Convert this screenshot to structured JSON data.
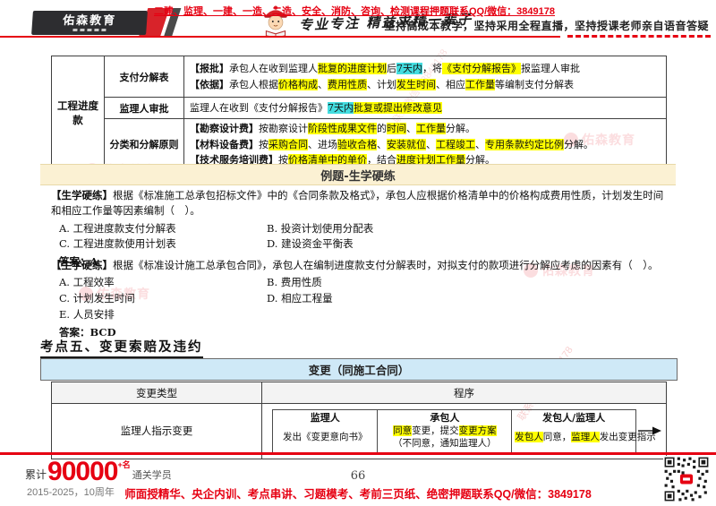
{
  "header": {
    "logo_text": "佑森教育",
    "slogan": "专业专注 精益求精一辈子",
    "courses_line": "二建、监理、一建、一造、二造、安全、消防、咨询、检测课程押题联系QQ/微信：3849178",
    "promise_line": "坚持高成本教学，坚持采用全程直播，坚持授课老师亲自语音答疑"
  },
  "table1": {
    "group_label": "工程进度款",
    "rows": [
      {
        "label": "支付分解表",
        "lines": [
          [
            {
              "t": "【报批】",
              "b": true
            },
            {
              "t": "承包人在收到监理人"
            },
            {
              "t": "批复的进度计划",
              "h": "y"
            },
            {
              "t": "后"
            },
            {
              "t": "7天内",
              "h": "c"
            },
            {
              "t": "，将"
            },
            {
              "t": "《支付分解报告》",
              "h": "y"
            },
            {
              "t": "报监理人审批"
            }
          ],
          [
            {
              "t": "【依据】",
              "b": true
            },
            {
              "t": "承包人根据"
            },
            {
              "t": "价格构成",
              "h": "y"
            },
            {
              "t": "、"
            },
            {
              "t": "费用性质",
              "h": "y"
            },
            {
              "t": "、计划"
            },
            {
              "t": "发生时间",
              "h": "y"
            },
            {
              "t": "、相应"
            },
            {
              "t": "工作量",
              "h": "y"
            },
            {
              "t": "等编制支付分解表"
            }
          ]
        ]
      },
      {
        "label": "监理人审批",
        "lines": [
          [
            {
              "t": "监理人在收到《支付分解报告》"
            },
            {
              "t": "7天内",
              "h": "c"
            },
            {
              "t": "批复或提出修改意见",
              "h": "y"
            }
          ]
        ]
      },
      {
        "label": "分类和分解原则",
        "lines": [
          [
            {
              "t": "【勘察设计费】",
              "b": true
            },
            {
              "t": "按勘察设计"
            },
            {
              "t": "阶段性成果文件",
              "h": "y"
            },
            {
              "t": "的"
            },
            {
              "t": "时间",
              "h": "y"
            },
            {
              "t": "、"
            },
            {
              "t": "工作量",
              "h": "y"
            },
            {
              "t": "分解。"
            }
          ],
          [
            {
              "t": "【材料设备费】",
              "b": true
            },
            {
              "t": "按"
            },
            {
              "t": "采购合同",
              "h": "y"
            },
            {
              "t": "、进场"
            },
            {
              "t": "验收合格",
              "h": "y"
            },
            {
              "t": "、"
            },
            {
              "t": "安装就位",
              "h": "y"
            },
            {
              "t": "、"
            },
            {
              "t": "工程竣工",
              "h": "y"
            },
            {
              "t": "、"
            },
            {
              "t": "专用条款约定比例",
              "h": "y"
            },
            {
              "t": "分解。"
            }
          ],
          [
            {
              "t": "【技术服务培训费】",
              "b": true
            },
            {
              "t": "按"
            },
            {
              "t": "价格清单中的单价",
              "h": "y"
            },
            {
              "t": "，结合"
            },
            {
              "t": "进度计划工作量",
              "h": "y"
            },
            {
              "t": "分解。"
            }
          ]
        ]
      }
    ]
  },
  "example_banner": "例题-生学硬练",
  "questions": [
    {
      "stem": [
        {
          "t": "【生学硬练】",
          "b": true
        },
        {
          "t": "根据《标准施工总承包招标文件》中的《合同条款及格式》，承包人应根据价格清单中的价格构成费用性质，计划发生时间和相应工作量等因素编制（　）。"
        }
      ],
      "options": [
        "A. 工程进度款支付分解表",
        "B. 投资计划使用分配表",
        "C. 工程进度款使用计划表",
        "D. 建设资金平衡表"
      ],
      "answer": "答案：A"
    },
    {
      "stem": [
        {
          "t": "【生学硬练】",
          "b": true
        },
        {
          "t": "根据《标准设计施工总承包合同》，承包人在编制进度款支付分解表时，对拟支付的款项进行分解应考虑的因素有（　）。"
        }
      ],
      "options": [
        "A. 工程效率",
        "B. 费用性质",
        "C. 计划发生时间",
        "D. 相应工程量",
        "E. 人员安排"
      ],
      "answer": "答案：BCD"
    }
  ],
  "section_title": "考点五、变更索赔及违约",
  "change_table": {
    "banner": "变更（同施工合同）",
    "headers": [
      "变更类型",
      "程序"
    ],
    "row_label": "监理人指示变更",
    "flow": [
      {
        "role": "监理人",
        "lines": [
          [
            {
              "t": "发出《变更意向书》"
            }
          ]
        ]
      },
      {
        "role": "承包人",
        "lines": [
          [
            {
              "t": "同意",
              "h": "y"
            },
            {
              "t": "变更，提交"
            },
            {
              "t": "变更方案",
              "h": "y"
            }
          ],
          [
            {
              "t": "（不同意，通知监理人）"
            }
          ]
        ]
      },
      {
        "role": "发包人/监理人",
        "lines": [
          [
            {
              "t": "发包人",
              "h": "y"
            },
            {
              "t": "同意，"
            },
            {
              "t": "监理人",
              "h": "y"
            },
            {
              "t": "发出变更指示"
            }
          ]
        ]
      }
    ]
  },
  "footer": {
    "cumulative_label": "累计",
    "count": "90000",
    "count_sup": "+名",
    "graduates_label": "通关学员",
    "years": "2015-2025，10周年",
    "page_number": "66",
    "promo_line": "师面授精华、央企内训、考点串讲、习题模考、考前三页纸、绝密押题联系QQ/微信：3849178"
  },
  "watermarks": {
    "logo_text": "佑森教育",
    "contact_text": "联系微信：3849178"
  },
  "colors": {
    "brand_red": "#e60012",
    "highlight_yellow": "#ffff00",
    "highlight_cyan": "#43dde0",
    "banner_cream": "#fbf1d3",
    "banner_blue": "#cfe9f7"
  }
}
